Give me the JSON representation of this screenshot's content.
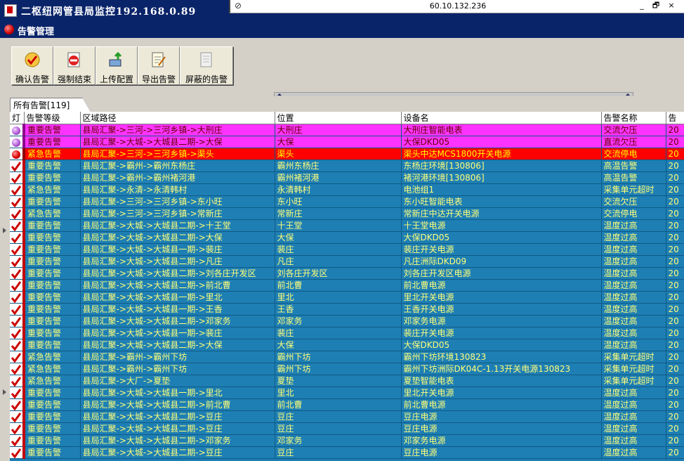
{
  "window": {
    "title": "二枢纽网管县局监控192.168.0.89"
  },
  "remote": {
    "ip": "60.10.132.236",
    "minimize": "_",
    "restore": "🗗",
    "close": "×"
  },
  "panel": {
    "title": "告警管理"
  },
  "toolbar": {
    "confirm_label": "确认告警",
    "force_end_label": "强制结束",
    "upload_label": "上传配置",
    "export_label": "导出告警",
    "masked_label": "屏蔽的告警"
  },
  "tab": {
    "label": "所有告警[119]"
  },
  "columns": [
    "灯",
    "告警等级",
    "区域路径",
    "位置",
    "设备名",
    "告警名称",
    "告"
  ],
  "rows": [
    {
      "lamp": "purple",
      "cells": [
        "重要告警",
        "县局汇聚->三河->三河乡镇->大刑庄",
        "大刑庄",
        "大刑庄智能电表",
        "交流欠压",
        "20"
      ]
    },
    {
      "lamp": "purple",
      "cells": [
        "重要告警",
        "县局汇聚->大城->大城县二期->大保",
        "大保",
        "大保DKD05",
        "直流欠压",
        "20"
      ]
    },
    {
      "lamp": "red",
      "cells": [
        "紧急告警",
        "县局汇聚->三河->三河乡镇->渠头",
        "渠头",
        "渠头中达MCS1800开关电源",
        "交流停电",
        "20"
      ]
    },
    {
      "lamp": "check",
      "cells": [
        "重要告警",
        "县局汇聚->霸州->霸州东杨庄",
        "霸州东杨庄",
        "东杨庄环境[130806]",
        "高温告警",
        "20"
      ]
    },
    {
      "lamp": "check",
      "cells": [
        "重要告警",
        "县局汇聚->霸州->霸州褚河港",
        "霸州褚河港",
        "褚河港环境[130806]",
        "高温告警",
        "20"
      ]
    },
    {
      "lamp": "check",
      "cells": [
        "紧急告警",
        "县局汇聚->永清->永清韩村",
        "永清韩村",
        "电池组1",
        "采集单元超时",
        "20"
      ]
    },
    {
      "lamp": "check",
      "cells": [
        "重要告警",
        "县局汇聚->三河->三河乡镇->东小旺",
        "东小旺",
        "东小旺智能电表",
        "交流欠压",
        "20"
      ]
    },
    {
      "lamp": "check",
      "cells": [
        "紧急告警",
        "县局汇聚->三河->三河乡镇->常新庄",
        "常新庄",
        "常新庄中达开关电源",
        "交流停电",
        "20"
      ]
    },
    {
      "lamp": "check",
      "cells": [
        "重要告警",
        "县局汇聚->大城->大城县二期->十王堂",
        "十王堂",
        "十王堂电源",
        "温度过高",
        "20"
      ]
    },
    {
      "lamp": "check",
      "cells": [
        "重要告警",
        "县局汇聚->大城->大城县二期->大保",
        "大保",
        "大保DKD05",
        "温度过高",
        "20"
      ]
    },
    {
      "lamp": "check",
      "cells": [
        "重要告警",
        "县局汇聚->大城->大城县一期->裴庄",
        "裴庄",
        "裴庄开关电源",
        "温度过高",
        "20"
      ]
    },
    {
      "lamp": "check",
      "cells": [
        "重要告警",
        "县局汇聚->大城->大城县二期->凡庄",
        "凡庄",
        "凡庄洲际DKD09",
        "温度过高",
        "20"
      ]
    },
    {
      "lamp": "check",
      "cells": [
        "重要告警",
        "县局汇聚->大城->大城县二期->刘各庄开发区",
        "刘各庄开发区",
        "刘各庄开发区电源",
        "温度过高",
        "20"
      ]
    },
    {
      "lamp": "check",
      "cells": [
        "重要告警",
        "县局汇聚->大城->大城县二期->前北曹",
        "前北曹",
        "前北曹电源",
        "温度过高",
        "20"
      ]
    },
    {
      "lamp": "check",
      "cells": [
        "重要告警",
        "县局汇聚->大城->大城县一期->里北",
        "里北",
        "里北开关电源",
        "温度过高",
        "20"
      ]
    },
    {
      "lamp": "check",
      "cells": [
        "重要告警",
        "县局汇聚->大城->大城县一期->王香",
        "王香",
        "王香开关电源",
        "温度过高",
        "20"
      ]
    },
    {
      "lamp": "check",
      "cells": [
        "重要告警",
        "县局汇聚->大城->大城县二期->邓家务",
        "邓家务",
        "邓家务电源",
        "温度过高",
        "20"
      ]
    },
    {
      "lamp": "check",
      "cells": [
        "重要告警",
        "县局汇聚->大城->大城县一期->裴庄",
        "裴庄",
        "裴庄开关电源",
        "温度过高",
        "20"
      ]
    },
    {
      "lamp": "check",
      "cells": [
        "重要告警",
        "县局汇聚->大城->大城县二期->大保",
        "大保",
        "大保DKD05",
        "温度过高",
        "20"
      ]
    },
    {
      "lamp": "check",
      "cells": [
        "紧急告警",
        "县局汇聚->霸州->霸州下坊",
        "霸州下坊",
        "霸州下坊环境130823",
        "采集单元超时",
        "20"
      ]
    },
    {
      "lamp": "check",
      "cells": [
        "紧急告警",
        "县局汇聚->霸州->霸州下坊",
        "霸州下坊",
        "霸州下坊洲际DK04C-1.13开关电源130823",
        "采集单元超时",
        "20"
      ]
    },
    {
      "lamp": "check",
      "cells": [
        "紧急告警",
        "县局汇聚->大厂->夏垫",
        "夏垫",
        "夏垫智能电表",
        "采集单元超时",
        "20"
      ]
    },
    {
      "lamp": "check",
      "cells": [
        "重要告警",
        "县局汇聚->大城->大城县一期->里北",
        "里北",
        "里北开关电源",
        "温度过高",
        "20"
      ]
    },
    {
      "lamp": "check",
      "cells": [
        "重要告警",
        "县局汇聚->大城->大城县二期->前北曹",
        "前北曹",
        "前北曹电源",
        "温度过高",
        "20"
      ]
    },
    {
      "lamp": "check",
      "cells": [
        "重要告警",
        "县局汇聚->大城->大城县二期->豆庄",
        "豆庄",
        "豆庄电源",
        "温度过高",
        "20"
      ]
    },
    {
      "lamp": "check",
      "cells": [
        "重要告警",
        "县局汇聚->大城->大城县二期->豆庄",
        "豆庄",
        "豆庄电源",
        "温度过高",
        "20"
      ]
    },
    {
      "lamp": "check",
      "cells": [
        "重要告警",
        "县局汇聚->大城->大城县二期->邓家务",
        "邓家务",
        "邓家务电源",
        "温度过高",
        "20"
      ]
    },
    {
      "lamp": "check",
      "cells": [
        "重要告警",
        "县局汇聚->大城->大城县二期->豆庄",
        "豆庄",
        "豆庄电源",
        "温度过高",
        "20"
      ]
    }
  ],
  "colors": {
    "grid_bg": "#1e7fb4",
    "grid_text": "#ffff7a",
    "magenta_row": "#ff33ff",
    "red_row": "#ff0000",
    "check": "#cc0000"
  }
}
